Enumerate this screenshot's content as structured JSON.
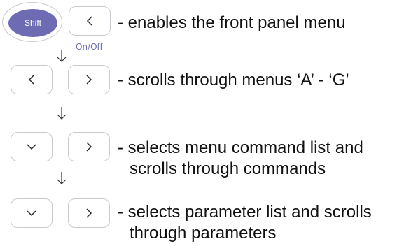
{
  "shift_key": {
    "label": "Shift",
    "color": "#6c6bb3"
  },
  "onoff_label": "On/Off",
  "steps": [
    {
      "keys": [
        "shift-key",
        "left-arrow-key"
      ],
      "desc_line1": "- enables the front panel menu",
      "desc_line2": ""
    },
    {
      "keys": [
        "left-arrow-key",
        "right-arrow-key"
      ],
      "desc_line1": "- scrolls through menus ‘A’ - ‘G’",
      "desc_line2": ""
    },
    {
      "keys": [
        "down-arrow-key",
        "right-arrow-key"
      ],
      "desc_line1": "- selects menu command list and",
      "desc_line2": "scrolls through commands"
    },
    {
      "keys": [
        "down-arrow-key",
        "right-arrow-key"
      ],
      "desc_line1": "- selects parameter list and scrolls",
      "desc_line2": "through parameters"
    }
  ]
}
